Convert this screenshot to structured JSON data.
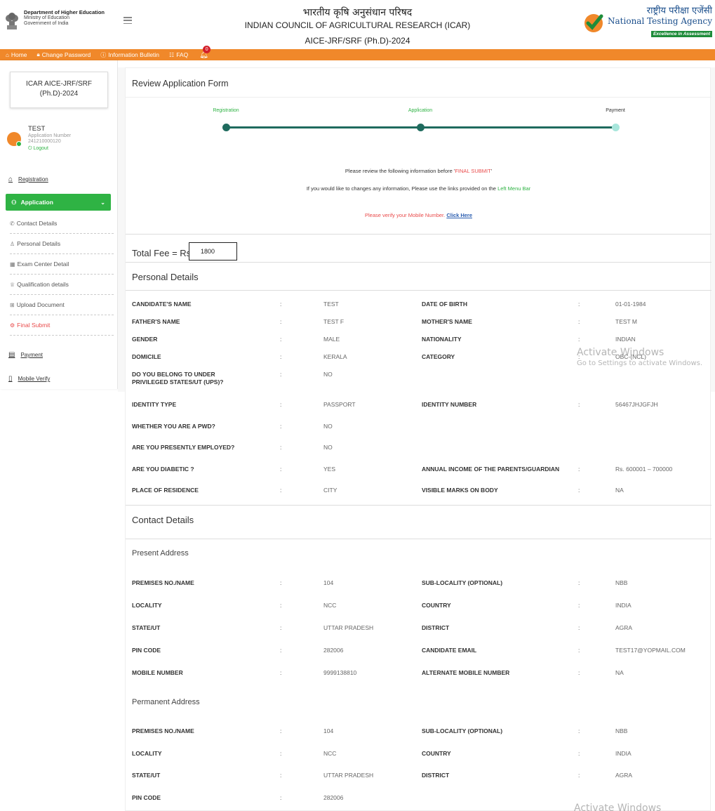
{
  "header": {
    "dept_line1": "Department of Higher Education",
    "dept_line2": "Ministry of Education",
    "dept_line3": "Government of India",
    "title_hindi": "भारतीय कृषि अनुसंधान परिषद",
    "title_eng": "INDIAN COUNCIL OF AGRICULTURAL RESEARCH (ICAR)",
    "title_exam": "AICE-JRF/SRF (Ph.D)-2024",
    "nta_hindi": "राष्ट्रीय परीक्षा एजेंसी",
    "nta_eng": "National Testing Agency",
    "nta_tag": "Excellence in Assessment"
  },
  "nav": {
    "home": "Home",
    "change_password": "Change Password",
    "info_bulletin": "Information Bulletin",
    "faq": "FAQ",
    "badge": "0"
  },
  "sidebar": {
    "exam_line1": "ICAR AICE-JRF/SRF",
    "exam_line2": "(Ph.D)-2024",
    "user_name": "TEST",
    "app_number_label": "Application Number",
    "app_number": "241210000120",
    "logout": "Logout",
    "registration": "Registration",
    "application": "Application",
    "sub_items": [
      "Contact Details",
      "Personal Details",
      "Exam Center Detail",
      "Qualification details",
      "Upload Document",
      "Final Submit"
    ],
    "payment": "Payment",
    "mobile_verify": "Mobile Verify"
  },
  "main": {
    "title": "Review Application Form",
    "steps": [
      "Registration",
      "Application",
      "Payment"
    ],
    "notice1_pre": "Please review the following information before '",
    "notice1_q": "FINAL SUBMIT",
    "notice1_post": "'",
    "notice2_pre": "If you would like to changes any information, Please use the links provided on the ",
    "notice2_link": "Left Menu Bar",
    "verify_text": "Please verify your Mobile Number. ",
    "verify_link": "Click Here",
    "fee_label": "Total Fee = Rs",
    "fee_value": "1800",
    "personal_title": "Personal Details",
    "contact_title": "Contact Details",
    "present_title": "Present Address",
    "permanent_title": "Permanent Address",
    "colon": ":"
  },
  "personal_rows_a": [
    {
      "l1": "CANDIDATE'S NAME",
      "v1": "TEST",
      "l2": "DATE OF BIRTH",
      "v2": "01-01-1984"
    },
    {
      "l1": "FATHER'S NAME",
      "v1": "TEST F",
      "l2": "MOTHER'S NAME",
      "v2": "TEST M"
    },
    {
      "l1": "GENDER",
      "v1": "MALE",
      "l2": "NATIONALITY",
      "v2": "INDIAN"
    },
    {
      "l1": "DOMICILE",
      "v1": "KERALA",
      "l2": "CATEGORY",
      "v2": "OBC-(NCL)"
    },
    {
      "l1": "DO YOU BELONG TO UNDER PRIVILEGED STATES/UT (UPS)?",
      "v1": "NO",
      "l2": "",
      "v2": ""
    }
  ],
  "personal_rows_b": [
    {
      "l1": "IDENTITY TYPE",
      "v1": "PASSPORT",
      "l2": "IDENTITY NUMBER",
      "v2": "56467JHJGFJH"
    },
    {
      "l1": "WHETHER YOU ARE A PWD?",
      "v1": "NO",
      "l2": "",
      "v2": ""
    },
    {
      "l1": "ARE YOU PRESENTLY EMPLOYED?",
      "v1": "NO",
      "l2": "",
      "v2": ""
    },
    {
      "l1": "ARE YOU DIABETIC ?",
      "v1": "YES",
      "l2": "ANNUAL INCOME OF THE PARENTS/GUARDIAN",
      "v2": "Rs. 600001 – 700000"
    },
    {
      "l1": "PLACE OF RESIDENCE",
      "v1": "CITY",
      "l2": "VISIBLE MARKS ON BODY",
      "v2": "NA"
    }
  ],
  "present_rows": [
    {
      "l1": "PREMISES NO./NAME",
      "v1": "104",
      "l2": "SUB-LOCALITY (OPTIONAL)",
      "v2": "NBB"
    },
    {
      "l1": "LOCALITY",
      "v1": "NCC",
      "l2": "COUNTRY",
      "v2": "INDIA"
    },
    {
      "l1": "STATE/UT",
      "v1": "UTTAR PRADESH",
      "l2": "DISTRICT",
      "v2": "AGRA"
    },
    {
      "l1": "PIN CODE",
      "v1": "282006",
      "l2": "CANDIDATE EMAIL",
      "v2": "TEST17@YOPMAIL.COM"
    },
    {
      "l1": "MOBILE NUMBER",
      "v1": "9999138810",
      "l2": "ALTERNATE MOBILE NUMBER",
      "v2": "NA"
    }
  ],
  "permanent_rows": [
    {
      "l1": "PREMISES NO./NAME",
      "v1": "104",
      "l2": "SUB-LOCALITY (OPTIONAL)",
      "v2": "NBB"
    },
    {
      "l1": "LOCALITY",
      "v1": "NCC",
      "l2": "COUNTRY",
      "v2": "INDIA"
    },
    {
      "l1": "STATE/UT",
      "v1": "UTTAR PRADESH",
      "l2": "DISTRICT",
      "v2": "AGRA"
    },
    {
      "l1": "PIN CODE",
      "v1": "282006",
      "l2": "",
      "v2": ""
    }
  ],
  "watermark": {
    "line1": "Activate Windows",
    "line2": "Go to Settings to activate Windows."
  },
  "colors": {
    "nav_orange": "#f0882a",
    "green": "#2fb344",
    "step_teal": "#1f6b5e",
    "alert_red": "#e94b4b"
  }
}
